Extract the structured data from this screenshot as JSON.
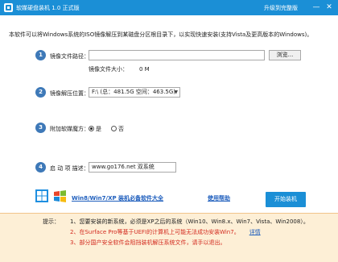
{
  "window": {
    "title": "软媒硬盘装机 1.0 正式版",
    "upgrade_link": "升级到完整版",
    "accent_color": "#1b8fd6",
    "icons": [
      "logo-icon",
      "minimize-icon",
      "close-icon"
    ]
  },
  "description": "本软件可以将Windows系统的ISO镜像解压到某磁盘分区根目录下，以实现快速安装(支持Vista及更高版本的Windows)。",
  "steps": [
    {
      "number": "1",
      "label": "镜像文件路径："
    },
    {
      "number": "2",
      "label": "镜像解压位置："
    },
    {
      "number": "3",
      "label": "附加软媒魔方："
    },
    {
      "number": "4",
      "label": "启 动 项 描述："
    }
  ],
  "iso": {
    "path_value": "",
    "browse_label": "浏览...",
    "size_label": "镜像文件大小：",
    "size_value": "0 M"
  },
  "extract": {
    "selected": "F:\\ (总：481.5G 空间：463.5G)"
  },
  "addon": {
    "yes_label": "是",
    "no_label": "否",
    "selected": "是"
  },
  "boot": {
    "description_value": "www.go176.net 双系统"
  },
  "footer": {
    "software_link": "Win8/Win7/XP 装机必备软件大全",
    "help_link": "使用帮助",
    "start_button": "开始装机"
  },
  "hints": {
    "title": "提示：",
    "items": [
      "1、您要安装的新系统，必须是XP之后的系统（Win10、Win8.x、Win7、Vista、Win2008）。",
      "2、在Surface Pro等基于UEFI的计算机上可能无法成功安装Win7。",
      "3、部分国产安全软件会阻挡装机解压系统文件，请手以退出。"
    ],
    "detail_link": "详情",
    "warning_color": "#d32a1f"
  }
}
